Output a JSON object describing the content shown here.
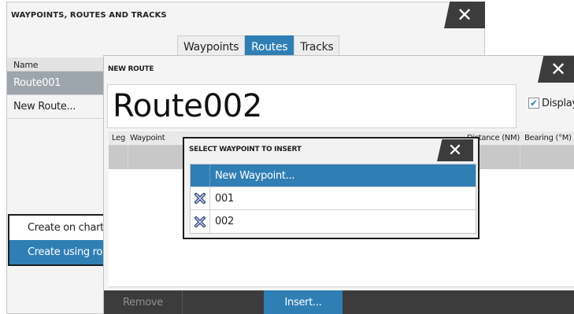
{
  "wrt": {
    "title": "WAYPOINTS, ROUTES AND TRACKS",
    "close": "✕",
    "tabs": [
      {
        "label": "Waypoints",
        "active": false
      },
      {
        "label": "Routes",
        "active": true
      },
      {
        "label": "Tracks",
        "active": false
      }
    ],
    "column_name": "Name",
    "rows": [
      {
        "label": "Route001",
        "selected": true
      },
      {
        "label": "New Route...",
        "selected": false
      }
    ]
  },
  "context_menu": {
    "items": [
      {
        "label": "Create on chart",
        "highlighted": false
      },
      {
        "label": "Create using rou",
        "highlighted": true
      }
    ]
  },
  "new_route": {
    "title": "NEW ROUTE",
    "close": "✕",
    "route_name": "Route002",
    "display_label": "Display",
    "display_checked": true,
    "check_mark": "✔",
    "columns": {
      "leg": "Leg",
      "waypoint": "Waypoint",
      "distance": "Distance (NM)",
      "bearing": "Bearing (°M)"
    },
    "buttons": {
      "remove": "Remove",
      "insert": "Insert..."
    }
  },
  "select_waypoint": {
    "title": "SELECT WAYPOINT TO INSERT",
    "close": "✕",
    "items": [
      {
        "label": "New Waypoint...",
        "icon": "none",
        "highlighted": true
      },
      {
        "label": "001",
        "icon": "waypoint-cross-icon",
        "highlighted": false
      },
      {
        "label": "002",
        "icon": "waypoint-cross-icon",
        "highlighted": false
      }
    ]
  },
  "colors": {
    "accent": "#2f7fb4",
    "titlebar_dark": "#3c3c3c",
    "selected_row": "#9da5ad"
  }
}
